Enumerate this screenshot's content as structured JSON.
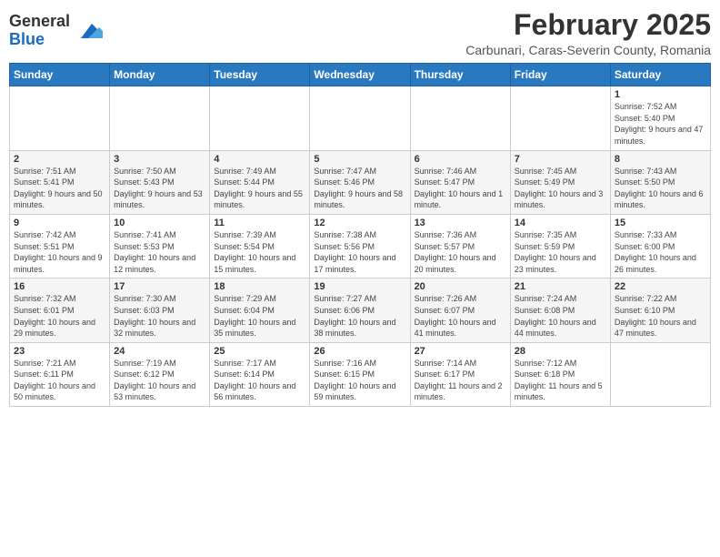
{
  "logo": {
    "general": "General",
    "blue": "Blue"
  },
  "title": {
    "month_year": "February 2025",
    "location": "Carbunari, Caras-Severin County, Romania"
  },
  "weekdays": [
    "Sunday",
    "Monday",
    "Tuesday",
    "Wednesday",
    "Thursday",
    "Friday",
    "Saturday"
  ],
  "weeks": [
    [
      {
        "day": "",
        "info": ""
      },
      {
        "day": "",
        "info": ""
      },
      {
        "day": "",
        "info": ""
      },
      {
        "day": "",
        "info": ""
      },
      {
        "day": "",
        "info": ""
      },
      {
        "day": "",
        "info": ""
      },
      {
        "day": "1",
        "info": "Sunrise: 7:52 AM\nSunset: 5:40 PM\nDaylight: 9 hours and 47 minutes."
      }
    ],
    [
      {
        "day": "2",
        "info": "Sunrise: 7:51 AM\nSunset: 5:41 PM\nDaylight: 9 hours and 50 minutes."
      },
      {
        "day": "3",
        "info": "Sunrise: 7:50 AM\nSunset: 5:43 PM\nDaylight: 9 hours and 53 minutes."
      },
      {
        "day": "4",
        "info": "Sunrise: 7:49 AM\nSunset: 5:44 PM\nDaylight: 9 hours and 55 minutes."
      },
      {
        "day": "5",
        "info": "Sunrise: 7:47 AM\nSunset: 5:46 PM\nDaylight: 9 hours and 58 minutes."
      },
      {
        "day": "6",
        "info": "Sunrise: 7:46 AM\nSunset: 5:47 PM\nDaylight: 10 hours and 1 minute."
      },
      {
        "day": "7",
        "info": "Sunrise: 7:45 AM\nSunset: 5:49 PM\nDaylight: 10 hours and 3 minutes."
      },
      {
        "day": "8",
        "info": "Sunrise: 7:43 AM\nSunset: 5:50 PM\nDaylight: 10 hours and 6 minutes."
      }
    ],
    [
      {
        "day": "9",
        "info": "Sunrise: 7:42 AM\nSunset: 5:51 PM\nDaylight: 10 hours and 9 minutes."
      },
      {
        "day": "10",
        "info": "Sunrise: 7:41 AM\nSunset: 5:53 PM\nDaylight: 10 hours and 12 minutes."
      },
      {
        "day": "11",
        "info": "Sunrise: 7:39 AM\nSunset: 5:54 PM\nDaylight: 10 hours and 15 minutes."
      },
      {
        "day": "12",
        "info": "Sunrise: 7:38 AM\nSunset: 5:56 PM\nDaylight: 10 hours and 17 minutes."
      },
      {
        "day": "13",
        "info": "Sunrise: 7:36 AM\nSunset: 5:57 PM\nDaylight: 10 hours and 20 minutes."
      },
      {
        "day": "14",
        "info": "Sunrise: 7:35 AM\nSunset: 5:59 PM\nDaylight: 10 hours and 23 minutes."
      },
      {
        "day": "15",
        "info": "Sunrise: 7:33 AM\nSunset: 6:00 PM\nDaylight: 10 hours and 26 minutes."
      }
    ],
    [
      {
        "day": "16",
        "info": "Sunrise: 7:32 AM\nSunset: 6:01 PM\nDaylight: 10 hours and 29 minutes."
      },
      {
        "day": "17",
        "info": "Sunrise: 7:30 AM\nSunset: 6:03 PM\nDaylight: 10 hours and 32 minutes."
      },
      {
        "day": "18",
        "info": "Sunrise: 7:29 AM\nSunset: 6:04 PM\nDaylight: 10 hours and 35 minutes."
      },
      {
        "day": "19",
        "info": "Sunrise: 7:27 AM\nSunset: 6:06 PM\nDaylight: 10 hours and 38 minutes."
      },
      {
        "day": "20",
        "info": "Sunrise: 7:26 AM\nSunset: 6:07 PM\nDaylight: 10 hours and 41 minutes."
      },
      {
        "day": "21",
        "info": "Sunrise: 7:24 AM\nSunset: 6:08 PM\nDaylight: 10 hours and 44 minutes."
      },
      {
        "day": "22",
        "info": "Sunrise: 7:22 AM\nSunset: 6:10 PM\nDaylight: 10 hours and 47 minutes."
      }
    ],
    [
      {
        "day": "23",
        "info": "Sunrise: 7:21 AM\nSunset: 6:11 PM\nDaylight: 10 hours and 50 minutes."
      },
      {
        "day": "24",
        "info": "Sunrise: 7:19 AM\nSunset: 6:12 PM\nDaylight: 10 hours and 53 minutes."
      },
      {
        "day": "25",
        "info": "Sunrise: 7:17 AM\nSunset: 6:14 PM\nDaylight: 10 hours and 56 minutes."
      },
      {
        "day": "26",
        "info": "Sunrise: 7:16 AM\nSunset: 6:15 PM\nDaylight: 10 hours and 59 minutes."
      },
      {
        "day": "27",
        "info": "Sunrise: 7:14 AM\nSunset: 6:17 PM\nDaylight: 11 hours and 2 minutes."
      },
      {
        "day": "28",
        "info": "Sunrise: 7:12 AM\nSunset: 6:18 PM\nDaylight: 11 hours and 5 minutes."
      },
      {
        "day": "",
        "info": ""
      }
    ]
  ]
}
